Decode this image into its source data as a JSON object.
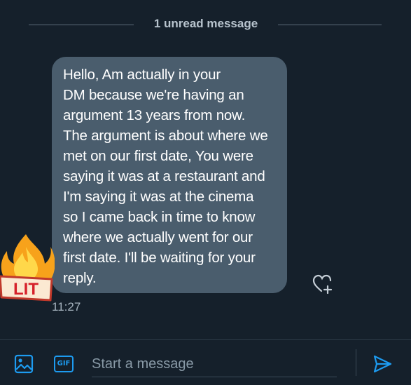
{
  "conversation": {
    "unread_divider": "1 unread message"
  },
  "message": {
    "text": "Hello, Am actually in your\nDM because we're having an\nargument 13 years from now.\nThe argument is about where we\nmet on our first date, You were\nsaying it was at a restaurant and\nI'm saying it was at the cinema\nso I came back in time to know\nwhere we actually went for our\nfirst date. I'll be waiting for your\nreply.",
    "time": "11:27",
    "sticker": {
      "label": "LIT",
      "icon": "fire-lit-sticker"
    },
    "reaction_icon": "heart-plus-icon"
  },
  "composer": {
    "placeholder": "Start a message",
    "value": "",
    "gif_label": "GIF",
    "icons": [
      "image-icon",
      "gif-icon",
      "send-icon"
    ]
  },
  "colors": {
    "background": "#15202b",
    "bubble": "#4a5d6d",
    "accent": "#1d9bf0",
    "muted_text": "#a7b4bf"
  }
}
